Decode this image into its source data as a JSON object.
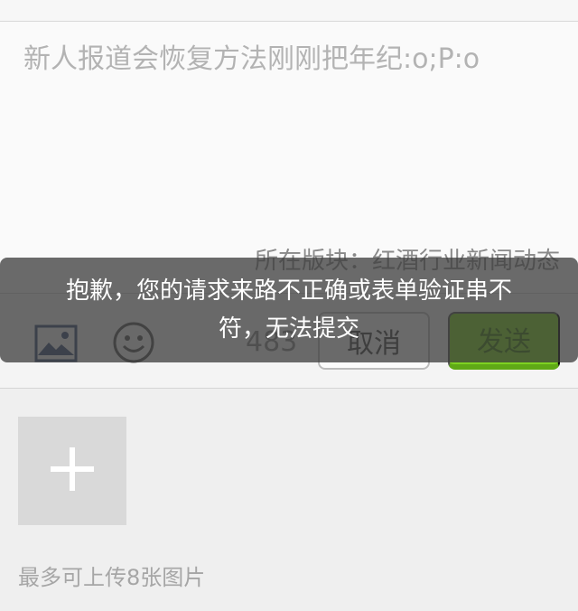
{
  "compose": {
    "text": "新人报道会恢复方法刚刚把年纪:o;P:o",
    "section_info": "所在版块：红酒行业新闻动态"
  },
  "toolbar": {
    "image_icon": "image-icon",
    "emoji_icon": "smile-icon",
    "char_count": "483",
    "cancel_label": "取消",
    "send_label": "发送"
  },
  "uploads": {
    "add_icon": "plus-icon",
    "hint": "最多可上传8张图片"
  },
  "toast": {
    "message": "抱歉，您的请求来路不正确或表单验证串不符，无法提交"
  },
  "colors": {
    "send_green": "#7ed321",
    "icon_blue": "#3d4f7a",
    "toast_bg": "#3c3c3c"
  }
}
